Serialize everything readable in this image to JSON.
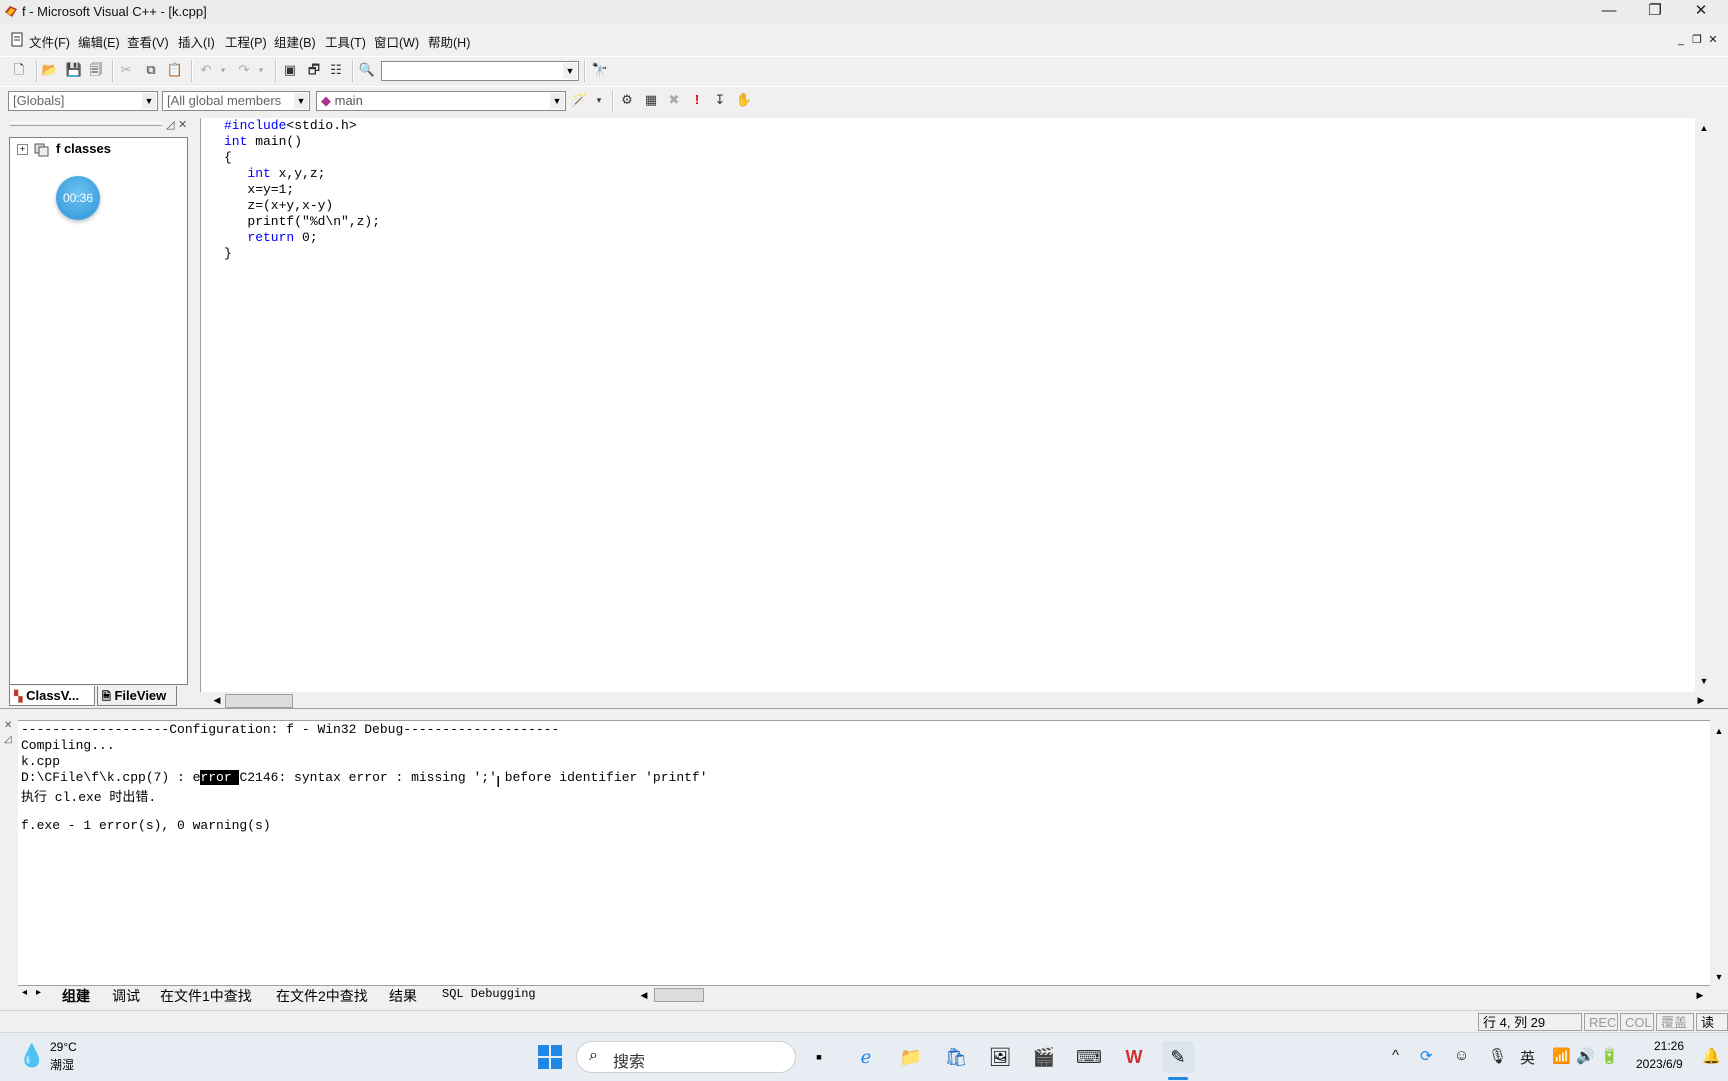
{
  "window": {
    "title": "f - Microsoft Visual C++ - [k.cpp]",
    "minimize": "—",
    "restore": "❐",
    "close": "✕"
  },
  "menu": {
    "items": [
      "文件(F)",
      "编辑(E)",
      "查看(V)",
      "插入(I)",
      "工程(P)",
      "组建(B)",
      "工具(T)",
      "窗口(W)",
      "帮助(H)"
    ]
  },
  "wizard_bar": {
    "class_combo": "[Globals]",
    "members_combo": "[All global members",
    "function_combo": "main"
  },
  "workspace": {
    "tree_root": "f classes",
    "timer_badge": "00:36",
    "tab_classview": "ClassV...",
    "tab_fileview": "FileView"
  },
  "editor": {
    "lines": [
      {
        "kw": "#include",
        "text": "<stdio.h>"
      },
      {
        "kw": "int",
        "text": " main()"
      },
      {
        "kw": "",
        "text": "{"
      },
      {
        "kw": "   int",
        "text": " x,y,z;"
      },
      {
        "kw": "",
        "text": "   x=y=1;"
      },
      {
        "kw": "",
        "text": "   z=(x+y,x-y)"
      },
      {
        "kw": "",
        "text": "   printf(\"%d\\n\",z);"
      },
      {
        "kw": "   return",
        "text": " 0;"
      },
      {
        "kw": "",
        "text": "}"
      }
    ]
  },
  "output": {
    "line1": "-------------------Configuration: f - Win32 Debug--------------------",
    "line2": "Compiling...",
    "line3": "k.cpp",
    "line4_prefix": "D:\\CFile\\f\\k.cpp(7) : e",
    "line4_highlight": "rror ",
    "line4_suffix": "C2146: syntax error : missing ';' before identifier 'printf'",
    "line5": "执行 cl.exe 时出错.",
    "line6": "",
    "line7": "f.exe - 1 error(s), 0 warning(s)",
    "tabs": [
      "组建",
      "调试",
      "在文件1中查找",
      "在文件2中查找",
      "结果",
      "SQL Debugging"
    ]
  },
  "status": {
    "position": "行 4, 列 29",
    "rec": "REC",
    "col": "COL",
    "ovr": "覆盖",
    "read": "读取"
  },
  "taskbar": {
    "weather_temp": "29°C",
    "weather_desc": "潮湿",
    "search_placeholder": "搜索",
    "ime": "英",
    "time": "21:26",
    "date": "2023/6/9"
  }
}
